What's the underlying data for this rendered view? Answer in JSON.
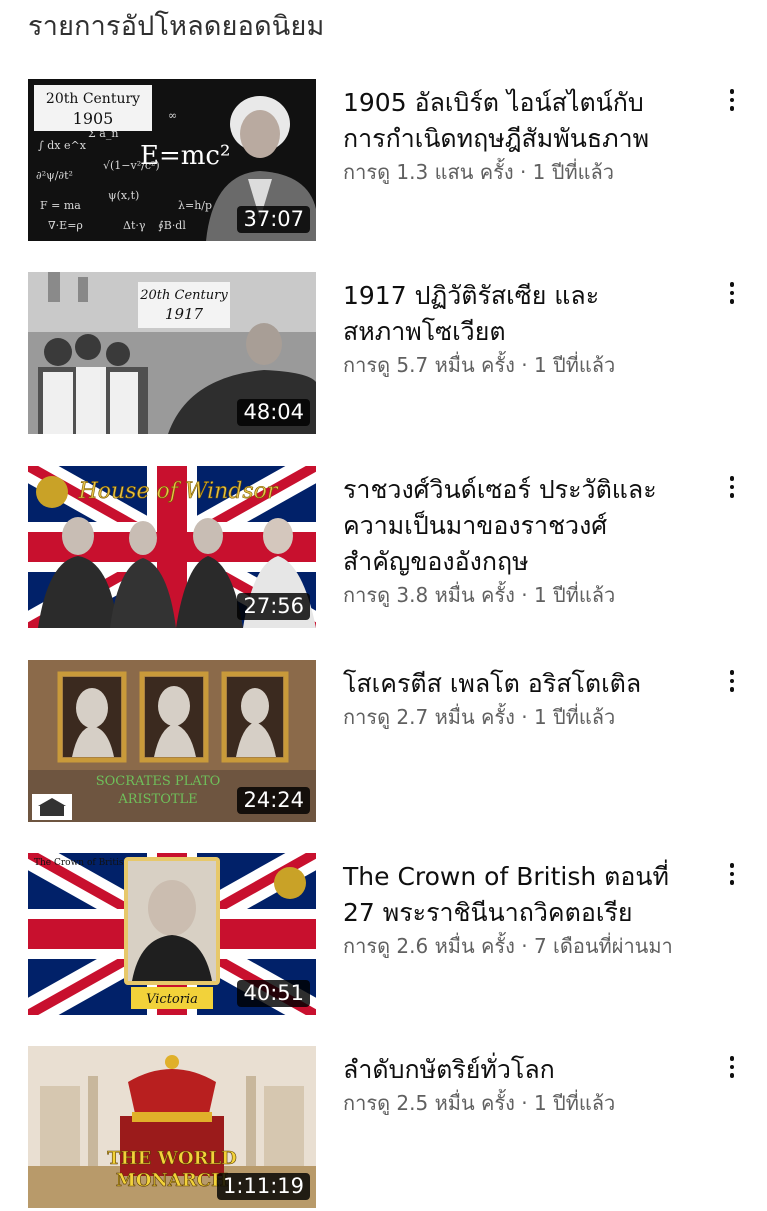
{
  "section_title": "รายการอัปโหลดยอดนิยม",
  "videos": [
    {
      "title": "1905 อัลเบิร์ต ไอน์สไตน์กับการกำเนิดทฤษฎีสัมพันธภาพ",
      "title_line1": "1905 อัลเบิร์ต ไอน์สไตน์กับ",
      "title_line2": "การกำเนิดทฤษฎีสัมพันธภาพ",
      "meta": "การดู 1.3 แสน ครั้ง · 1 ปีที่แล้ว",
      "duration": "37:07",
      "thumb_text1": "20th Century",
      "thumb_text2": "1905",
      "thumb_formula": "E=mc²"
    },
    {
      "title_line1": "1917 ปฏิวัติรัสเซีย และ",
      "title_line2": "สหภาพโซเวียต",
      "meta": "การดู 5.7 หมื่น ครั้ง · 1 ปีที่แล้ว",
      "duration": "48:04",
      "thumb_text1": "20th Century",
      "thumb_text2": "1917"
    },
    {
      "title_line1": "ราชวงศ์วินด์เซอร์ ประวัติและ",
      "title_line2": "ความเป็นมาของราชวงศ์",
      "title_line3": "สำคัญของอังกฤษ",
      "meta": "การดู 3.8 หมื่น ครั้ง · 1 ปีที่แล้ว",
      "duration": "27:56",
      "thumb_text1": "House of Windsor"
    },
    {
      "title_line1": "โสเครตีส เพลโต อริสโตเติล",
      "meta": "การดู 2.7 หมื่น ครั้ง · 1 ปีที่แล้ว",
      "duration": "24:24",
      "thumb_text1": "SOCRATES PLATO",
      "thumb_text2": "ARISTOTLE"
    },
    {
      "title_line1": "The Crown of British ตอนที่",
      "title_line2": "27 พระราชินีนาถวิคตอเรีย",
      "meta": "การดู 2.6 หมื่น ครั้ง · 7 เดือนที่ผ่านมา",
      "duration": "40:51",
      "thumb_text1": "The Crown of British",
      "thumb_text2": "Victoria"
    },
    {
      "title_line1": "ลำดับกษัตริย์ทั่วโลก",
      "meta": "การดู 2.5 หมื่น ครั้ง · 1 ปีที่แล้ว",
      "duration": "1:11:19",
      "thumb_text1": "THE WORLD",
      "thumb_text2": "MONARCH"
    }
  ],
  "colors": {
    "union_red": "#c8102e",
    "union_blue": "#012169",
    "meta_gray": "#606060"
  }
}
